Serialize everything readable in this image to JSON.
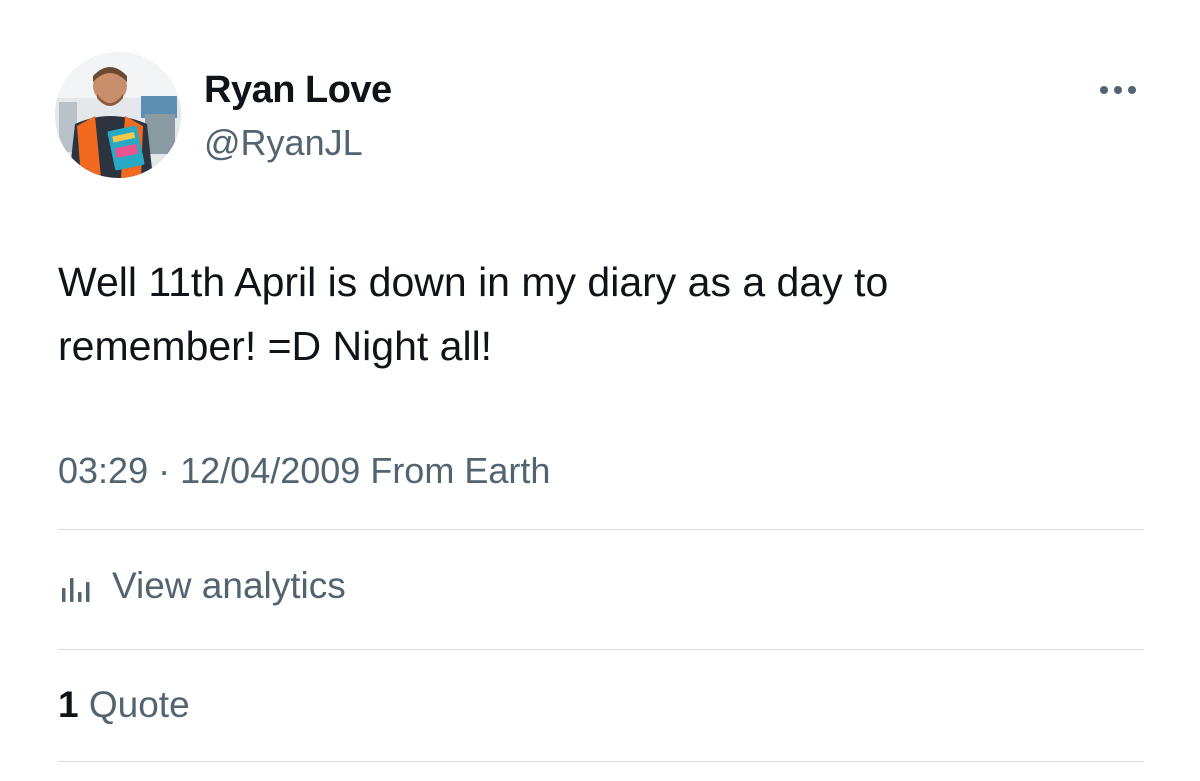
{
  "author": {
    "display_name": "Ryan Love",
    "handle": "@RyanJL"
  },
  "tweet": {
    "text_line1": "Well 11th April is down in my diary as a day to",
    "text_line2": "remember! =D Night all!",
    "time": "03:29",
    "separator": "·",
    "date": "12/04/2009",
    "source": "From Earth"
  },
  "actions": {
    "analytics_label": "View analytics",
    "analytics_icon": "bar-chart-icon",
    "more_icon": "ellipsis-icon"
  },
  "engagement": {
    "quote_count": "1",
    "quote_label": "Quote"
  },
  "colors": {
    "text_primary": "#0f1419",
    "text_secondary": "#536471",
    "divider": "#d9dde1",
    "background": "#ffffff"
  }
}
